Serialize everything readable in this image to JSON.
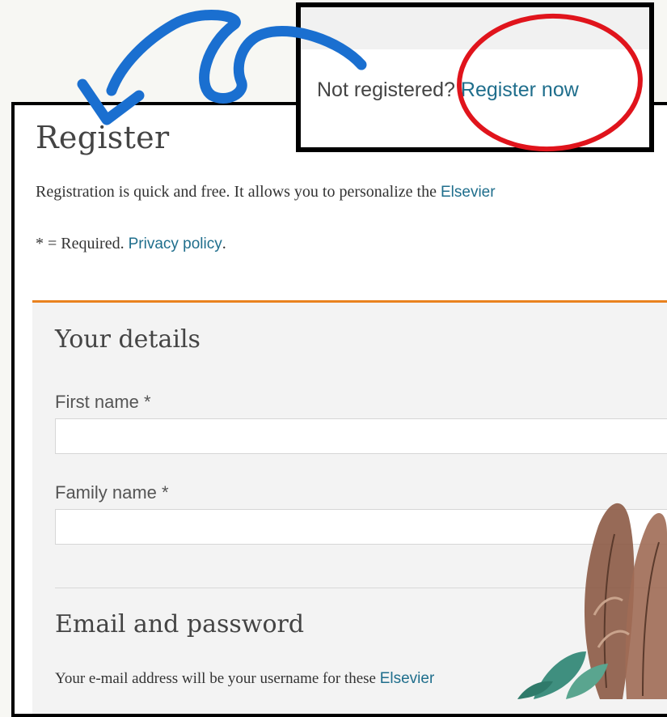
{
  "callout": {
    "prompt": "Not registered?",
    "link": "Register now"
  },
  "register_page": {
    "title": "Register",
    "intro_text": "Registration is quick and free. It allows you to personalize the",
    "intro_link": "Elsevier",
    "required_text": "* = Required.",
    "privacy_link": "Privacy policy",
    "required_tail": "."
  },
  "details_section": {
    "heading": "Your details",
    "first_name_label": "First name *",
    "first_name_value": "",
    "family_name_label": "Family name *",
    "family_name_value": ""
  },
  "email_section": {
    "heading": "Email and password",
    "text": "Your e-mail address will be your username for these",
    "link": "Elsevier"
  },
  "colors": {
    "accent_rule": "#e9821f",
    "link": "#1f6e8c",
    "highlight_circle": "#e0141c",
    "arrow": "#1a6fd0"
  },
  "icons": [
    "curved-arrow-icon",
    "feather-decoration-icon",
    "leaf-decoration-icon"
  ]
}
